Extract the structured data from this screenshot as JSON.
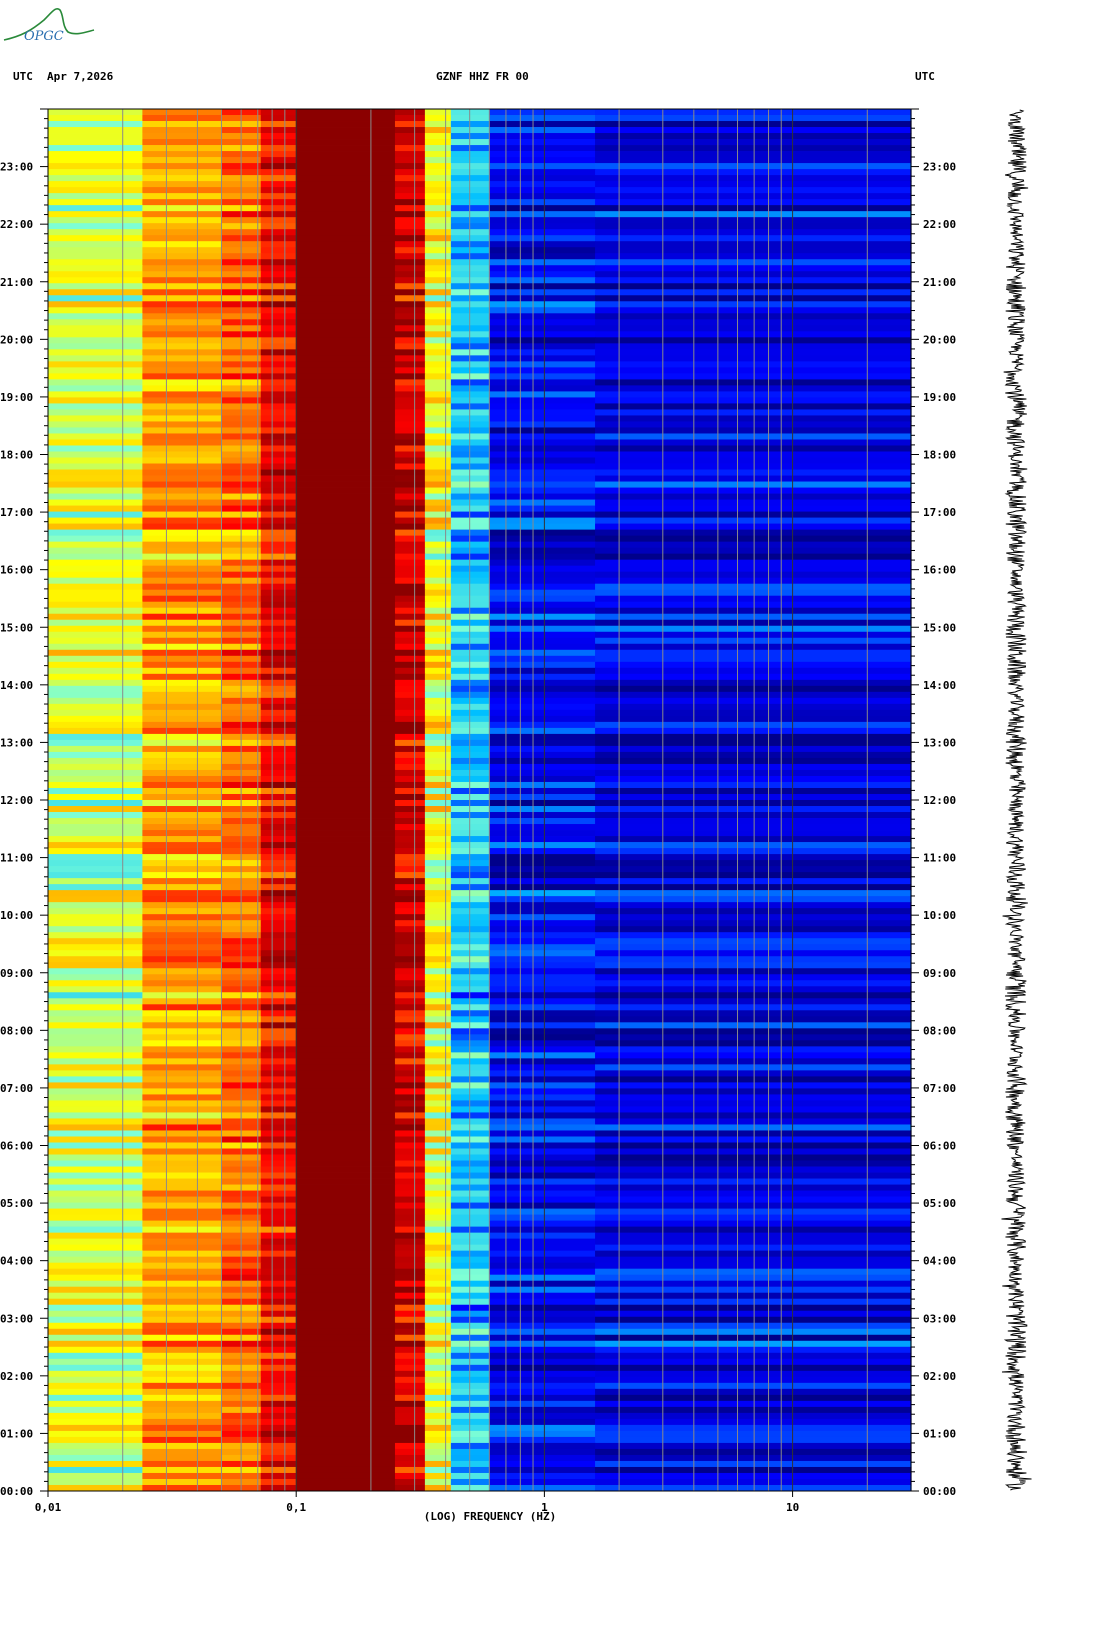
{
  "header": {
    "left_tz": "UTC",
    "date": "Apr 7,2026",
    "station": "GZNF HHZ FR 00",
    "right_tz": "UTC"
  },
  "logo": {
    "text": "OPGC",
    "color": "#2a8a3a"
  },
  "chart_data": {
    "type": "heatmap",
    "title": "GZNF HHZ FR 00",
    "xlabel": "(LOG) FREQUENCY (HZ)",
    "x_scale": "log",
    "xlim": [
      0.01,
      30
    ],
    "x_tick_labels": [
      "0,01",
      "0,1",
      "1",
      "10"
    ],
    "x_ticks": [
      0.01,
      0.1,
      1,
      10
    ],
    "y_unit": "UTC hour",
    "ylim": [
      0,
      24
    ],
    "y_tick_labels": [
      "00:00",
      "01:00",
      "02:00",
      "03:00",
      "04:00",
      "05:00",
      "06:00",
      "07:00",
      "08:00",
      "09:00",
      "10:00",
      "11:00",
      "12:00",
      "13:00",
      "14:00",
      "15:00",
      "16:00",
      "17:00",
      "18:00",
      "19:00",
      "20:00",
      "21:00",
      "22:00",
      "23:00"
    ],
    "colormap": [
      "#00008b",
      "#0000ff",
      "#00bfff",
      "#7fffd4",
      "#ffff00",
      "#ff8c00",
      "#ff0000",
      "#8b0000"
    ],
    "frequency_bands": [
      {
        "f_from": 0.01,
        "f_to": 0.024,
        "level": 0.52
      },
      {
        "f_from": 0.024,
        "f_to": 0.05,
        "level": 0.68
      },
      {
        "f_from": 0.05,
        "f_to": 0.072,
        "level": 0.74
      },
      {
        "f_from": 0.072,
        "f_to": 0.1,
        "level": 0.86
      },
      {
        "f_from": 0.1,
        "f_to": 0.25,
        "level": 1.0
      },
      {
        "f_from": 0.25,
        "f_to": 0.33,
        "level": 0.9
      },
      {
        "f_from": 0.33,
        "f_to": 0.42,
        "level": 0.55
      },
      {
        "f_from": 0.42,
        "f_to": 0.6,
        "level": 0.3
      },
      {
        "f_from": 0.6,
        "f_to": 1.6,
        "level": 0.12
      },
      {
        "f_from": 1.6,
        "f_to": 30,
        "level": 0.1
      }
    ],
    "seismogram": {
      "type": "line",
      "orientation": "vertical"
    },
    "colors": {
      "axis": "#000000",
      "gridline": "#8a8a8a",
      "background": "#ffffff"
    }
  }
}
